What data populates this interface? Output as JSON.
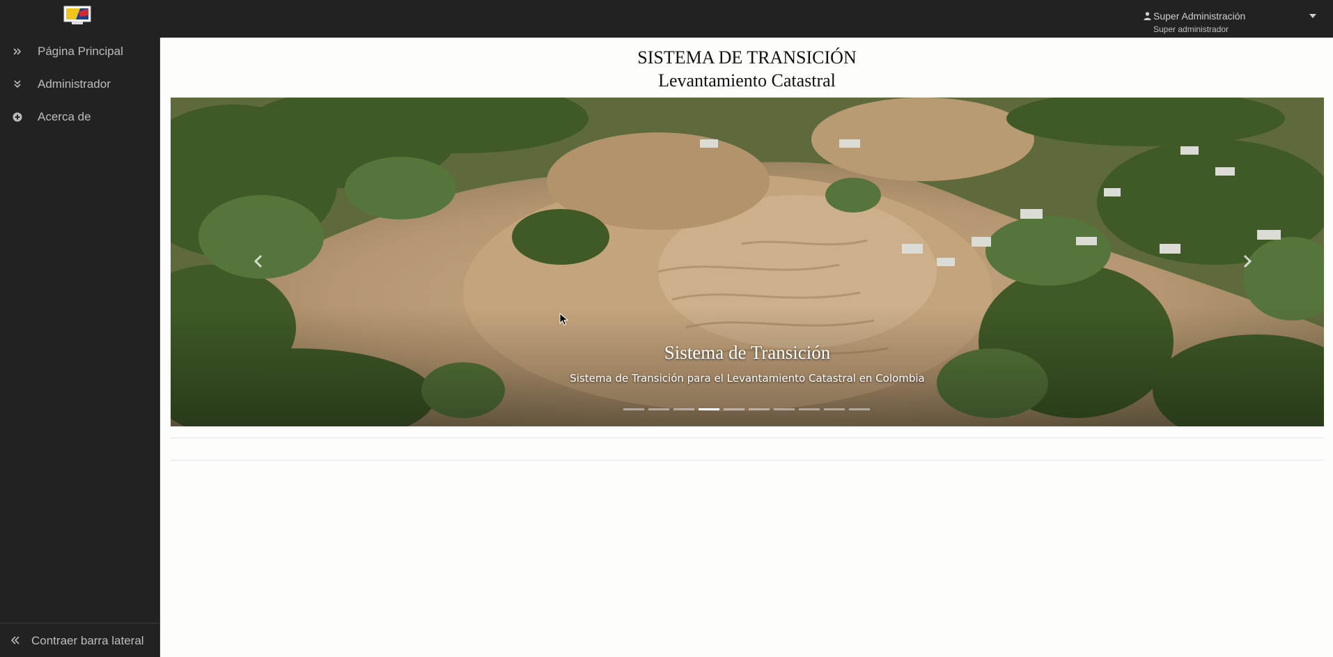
{
  "header": {
    "user_name": "Super Administración",
    "user_role": "Super administrador"
  },
  "sidebar": {
    "items": [
      {
        "label": "Página Principal",
        "icon": "double-chevron-right-icon"
      },
      {
        "label": "Administrador",
        "icon": "double-chevron-down-icon"
      },
      {
        "label": "Acerca de",
        "icon": "plus-circle-icon"
      }
    ],
    "collapse_label": "Contraer barra lateral"
  },
  "main": {
    "title_line1": "SISTEMA DE TRANSICIÓN",
    "title_line2": "Levantamiento Catastral"
  },
  "carousel": {
    "caption_title": "Sistema de Transición",
    "caption_text": "Sistema de Transición para el Levantamiento Catastral en Colombia",
    "slide_count": 10,
    "active_slide": 4
  },
  "colors": {
    "topbar": "#222222",
    "sidebar": "#222222",
    "background": "#fdfdfb"
  }
}
